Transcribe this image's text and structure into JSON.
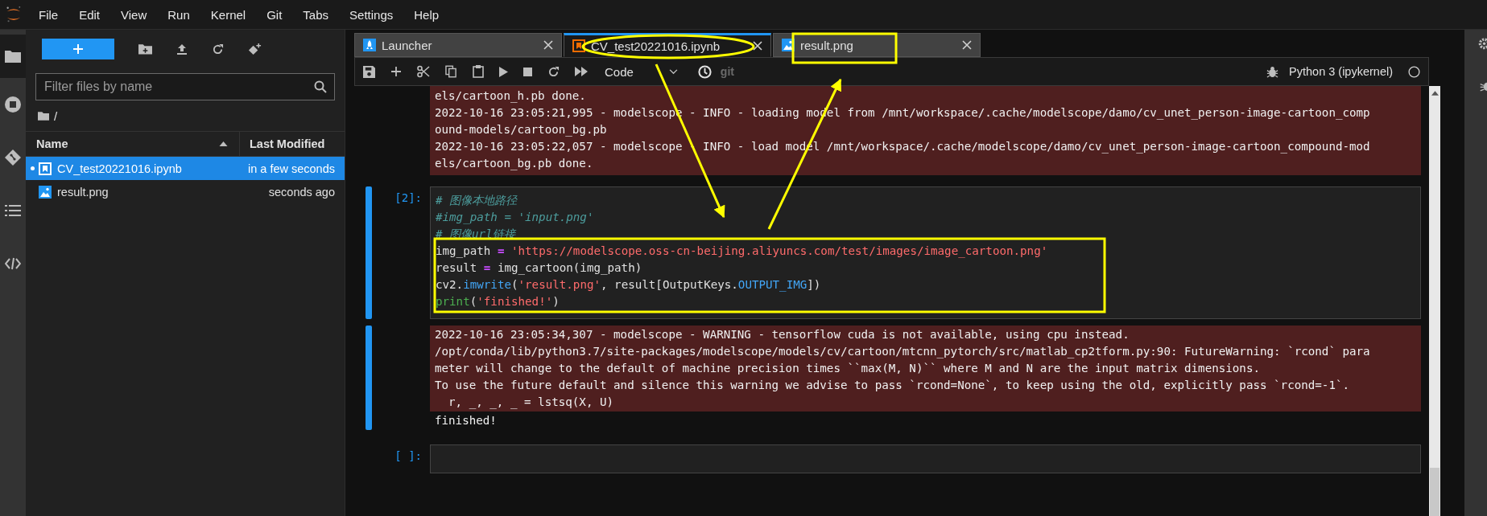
{
  "menu": [
    "File",
    "Edit",
    "View",
    "Run",
    "Kernel",
    "Git",
    "Tabs",
    "Settings",
    "Help"
  ],
  "file_browser": {
    "filter": {
      "placeholder": "Filter files by name"
    },
    "path": "/",
    "columns": [
      "Name",
      "Last Modified"
    ],
    "files": [
      {
        "name": "CV_test20221016.ipynb",
        "modified": "in a few seconds",
        "kind": "notebook",
        "running": true,
        "selected": true
      },
      {
        "name": "result.png",
        "modified": "seconds ago",
        "kind": "image",
        "running": false,
        "selected": false
      }
    ]
  },
  "tabs": [
    {
      "label": "Launcher",
      "kind": "launcher",
      "selected": false
    },
    {
      "label": "CV_test20221016.ipynb",
      "kind": "notebook",
      "selected": true
    },
    {
      "label": "result.png",
      "kind": "image",
      "selected": false
    }
  ],
  "toolbar": {
    "cell_type": "Code",
    "git": "git",
    "kernel": "Python 3 (ipykernel)"
  },
  "cells": [
    {
      "selected": false,
      "outputs": [
        {
          "kind": "stderr",
          "lines": [
            "els/cartoon_h.pb done.",
            "2022-10-16 23:05:21,995 - modelscope - INFO - loading model from /mnt/workspace/.cache/modelscope/damo/cv_unet_person-image-cartoon_comp",
            "ound-models/cartoon_bg.pb",
            "2022-10-16 23:05:22,057 - modelscope - INFO - load model /mnt/workspace/.cache/modelscope/damo/cv_unet_person-image-cartoon_compound-mod",
            "els/cartoon_bg.pb done."
          ]
        }
      ]
    },
    {
      "selected": true,
      "prompt": "[2]:",
      "code": [
        [
          {
            "text": "# 图像本地路径",
            "kind": "comment"
          }
        ],
        [
          {
            "text": "#img_path = 'input.png'",
            "kind": "comment"
          }
        ],
        [
          {
            "text": "# 图像url链接",
            "kind": "comment"
          }
        ],
        [
          {
            "text": "img_path",
            "kind": "plain"
          },
          {
            "text": " = ",
            "kind": "operator"
          },
          {
            "text": "'https://modelscope.oss-cn-beijing.aliyuncs.com/test/images/image_cartoon.png'",
            "kind": "string"
          }
        ],
        [
          {
            "text": "result",
            "kind": "plain"
          },
          {
            "text": " = ",
            "kind": "operator"
          },
          {
            "text": "img_cartoon(img_path)",
            "kind": "plain"
          }
        ],
        [
          {
            "text": "cv2.",
            "kind": "plain"
          },
          {
            "text": "imwrite",
            "kind": "attr"
          },
          {
            "text": "(",
            "kind": "plain"
          },
          {
            "text": "'result.png'",
            "kind": "string"
          },
          {
            "text": ", result[OutputKeys.",
            "kind": "plain"
          },
          {
            "text": "OUTPUT_IMG",
            "kind": "attr"
          },
          {
            "text": "])",
            "kind": "plain"
          }
        ],
        [
          {
            "text": "print",
            "kind": "builtin"
          },
          {
            "text": "(",
            "kind": "plain"
          },
          {
            "text": "'finished!'",
            "kind": "string"
          },
          {
            "text": ")",
            "kind": "plain"
          }
        ]
      ],
      "outputs": [
        {
          "kind": "stderr",
          "lines": [
            "2022-10-16 23:05:34,307 - modelscope - WARNING - tensorflow cuda is not available, using cpu instead.",
            "/opt/conda/lib/python3.7/site-packages/modelscope/models/cv/cartoon/mtcnn_pytorch/src/matlab_cp2tform.py:90: FutureWarning: `rcond` para",
            "meter will change to the default of machine precision times ``max(M, N)`` where M and N are the input matrix dimensions.",
            "To use the future default and silence this warning we advise to pass `rcond=None`, to keep using the old, explicitly pass `rcond=-1`.",
            "  r, _, _, _ = lstsq(X, U)"
          ]
        },
        {
          "kind": "stdout",
          "lines": [
            "finished!"
          ]
        }
      ]
    },
    {
      "selected": false,
      "prompt": "[ ]:"
    }
  ]
}
